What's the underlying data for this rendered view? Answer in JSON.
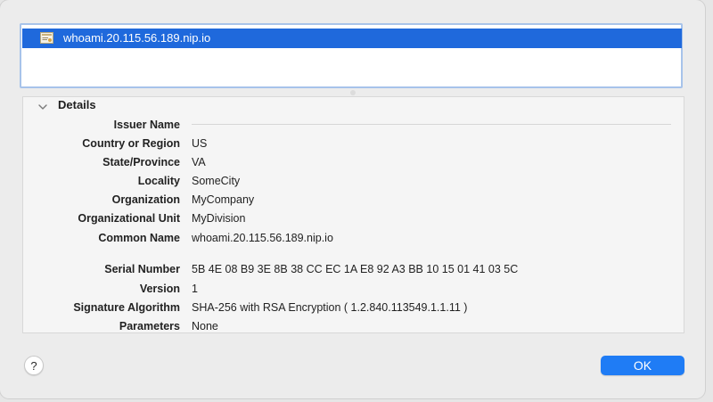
{
  "certificate_list": {
    "items": [
      {
        "name": "whoami.20.115.56.189.nip.io",
        "selected": true
      }
    ]
  },
  "details": {
    "title": "Details",
    "expanded": true,
    "fields": {
      "issuer_name": {
        "label": "Issuer Name",
        "value": ""
      },
      "country": {
        "label": "Country or Region",
        "value": "US"
      },
      "state": {
        "label": "State/Province",
        "value": "VA"
      },
      "locality": {
        "label": "Locality",
        "value": "SomeCity"
      },
      "organization": {
        "label": "Organization",
        "value": "MyCompany"
      },
      "org_unit": {
        "label": "Organizational Unit",
        "value": "MyDivision"
      },
      "common_name": {
        "label": "Common Name",
        "value": "whoami.20.115.56.189.nip.io"
      },
      "serial_number": {
        "label": "Serial Number",
        "value": "5B 4E 08 B9 3E 8B 38 CC EC 1A E8 92 A3 BB 10 15 01 41 03 5C"
      },
      "version": {
        "label": "Version",
        "value": "1"
      },
      "signature_algorithm": {
        "label": "Signature Algorithm",
        "value": "SHA-256 with RSA Encryption ( 1.2.840.113549.1.1.11 )"
      },
      "parameters": {
        "label": "Parameters",
        "value": "None"
      }
    }
  },
  "buttons": {
    "help_label": "?",
    "ok_label": "OK"
  },
  "colors": {
    "selection": "#1f69dc",
    "primary_button": "#1f7cf5"
  },
  "icons": {
    "certificate": "certificate-icon",
    "disclosure": "chevron-down-icon"
  }
}
